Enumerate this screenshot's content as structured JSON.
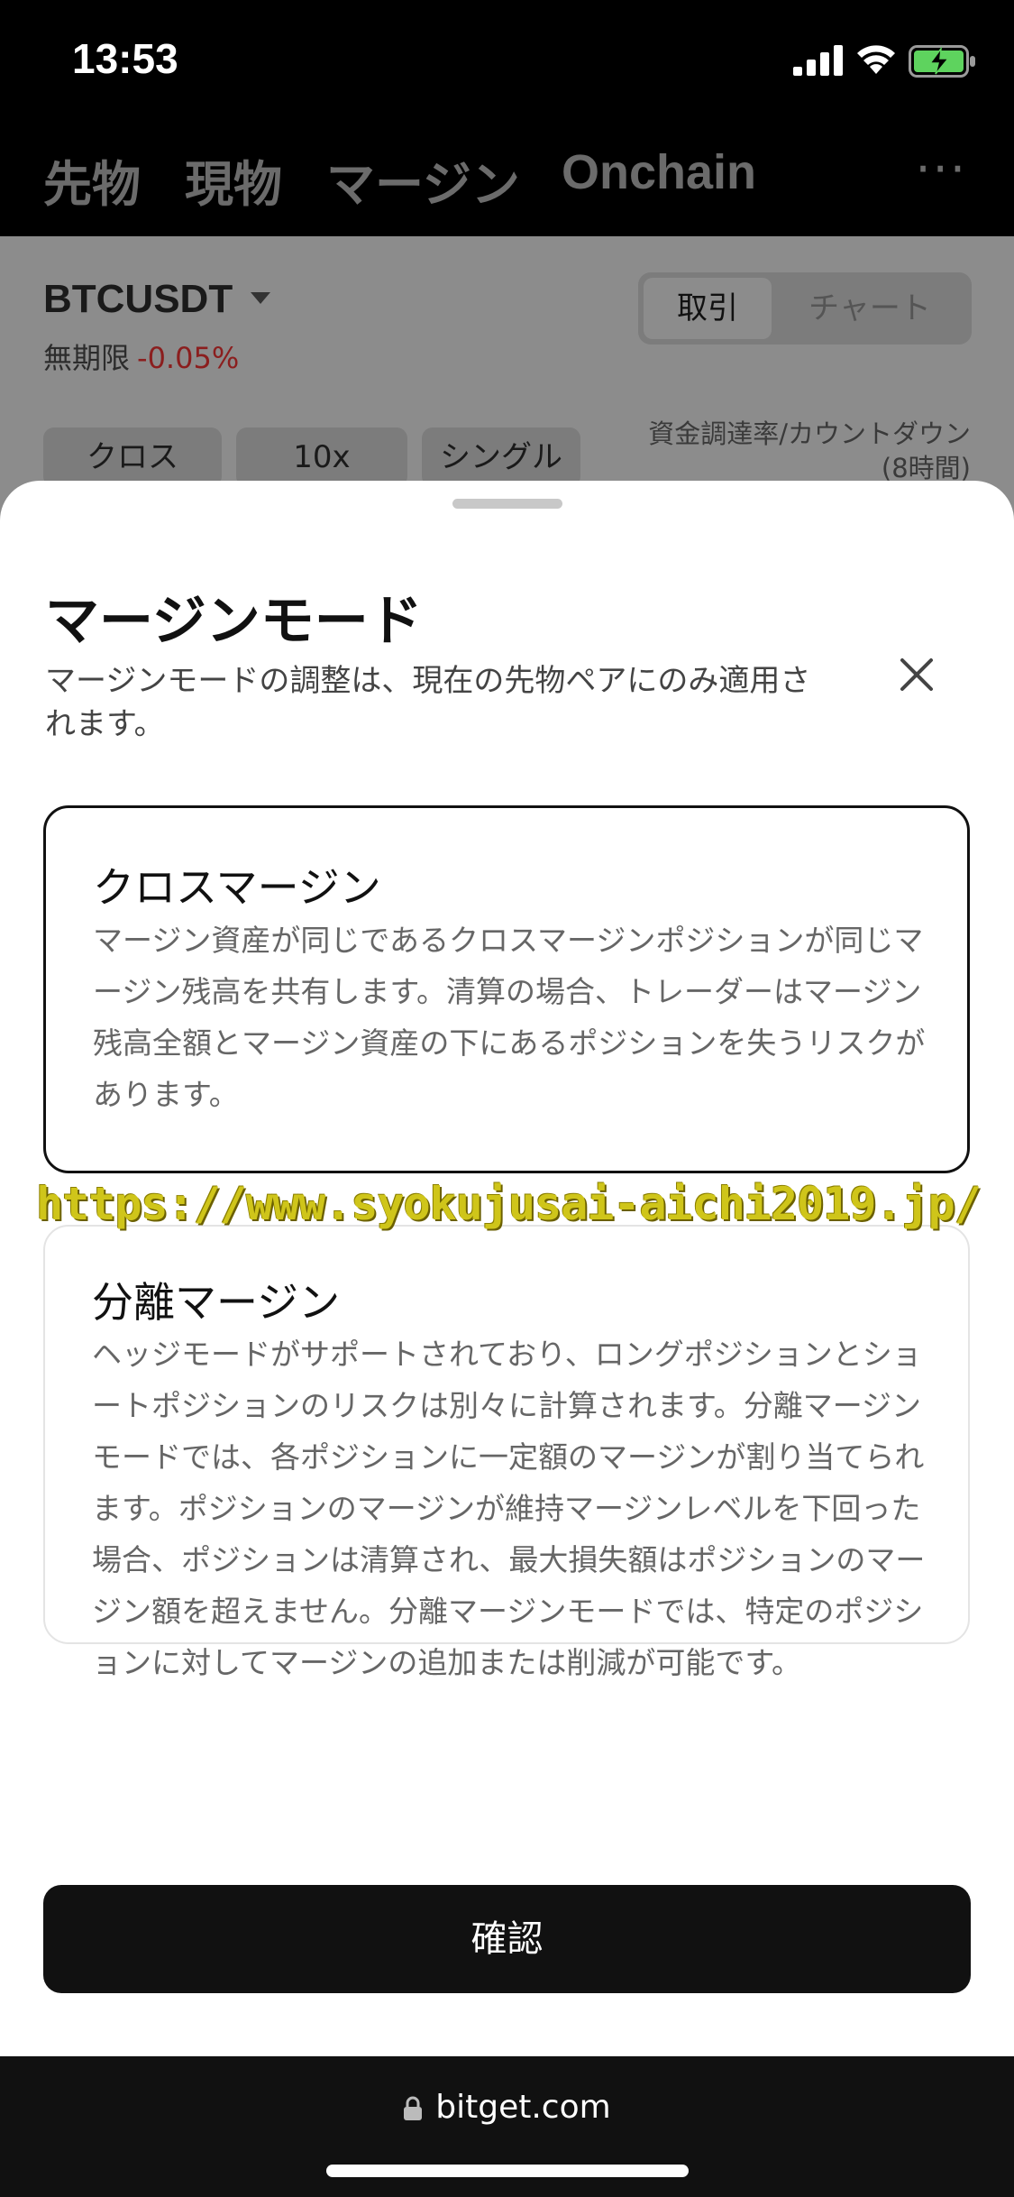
{
  "status_bar": {
    "time": "13:53"
  },
  "top_nav": {
    "tabs": [
      "先物",
      "現物",
      "マージン",
      "Onchain"
    ],
    "more_label": "···"
  },
  "trading": {
    "pair": "BTCUSDT",
    "perpetual_label": "無期限",
    "change": "-0.05%",
    "view_tabs": [
      "取引",
      "チャート"
    ],
    "mode_pills": [
      "クロス",
      "10x",
      "シングル"
    ],
    "funding_label": "資金調達率/カウントダウン",
    "funding_interval": "(8時間)"
  },
  "sheet": {
    "title": "マージンモード",
    "subtitle": "マージンモードの調整は、現在の先物ペアにのみ適用されます。",
    "options": [
      {
        "title": "クロスマージン",
        "description": "マージン資産が同じであるクロスマージンポジションが同じマージン残高を共有します。清算の場合、トレーダーはマージン残高全額とマージン資産の下にあるポジションを失うリスクがあります。",
        "selected": true
      },
      {
        "title": "分離マージン",
        "description": "ヘッジモードがサポートされており、ロングポジションとショートポジションのリスクは別々に計算されます。分離マージンモードでは、各ポジションに一定額のマージンが割り当てられます。ポジションのマージンが維持マージンレベルを下回った場合、ポジションは清算され、最大損失額はポジションのマージン額を超えません。分離マージンモードでは、特定のポジションに対してマージンの追加または削減が可能です。",
        "selected": false
      }
    ],
    "confirm_label": "確認"
  },
  "watermark": "https://www.syokujusai-aichi2019.jp/",
  "browser": {
    "url": "bitget.com"
  },
  "colors": {
    "negative": "#d0443e",
    "primary_button": "#111111",
    "watermark": "#cfc51a"
  }
}
